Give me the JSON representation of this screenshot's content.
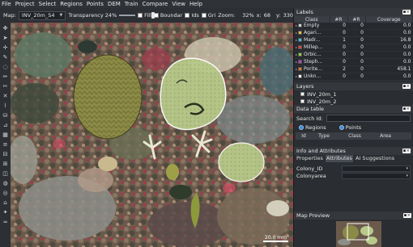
{
  "menu": [
    "File",
    "Project",
    "Select",
    "Regions",
    "Points",
    "DEM",
    "Train",
    "Compare",
    "View",
    "Help"
  ],
  "toolbar": {
    "map_label": "Map:",
    "map_value": "INV_20m_S4",
    "transparency_label": "Transparency 24%",
    "transparency": 0.24,
    "fill_label": "Fill",
    "boundaries_label": "Boundar",
    "ids_label": "Ids",
    "grid_label": "Gri",
    "zoom_label": "Zoom:",
    "zoom_value": "32%",
    "x_label": "x:",
    "x_value": "68",
    "y_label": "y:",
    "y_value": "330"
  },
  "map": {
    "scale_text": "20.0 mm"
  },
  "labels_panel": {
    "title": "Labels",
    "columns": [
      "Class",
      "#R",
      "#R",
      "Coverage"
    ],
    "rows": [
      {
        "name": "Empty",
        "color": "#cfcfcf",
        "r1": "0",
        "r2": "0",
        "coverage": "0.0"
      },
      {
        "name": "Agari...",
        "color": "#e8c23a",
        "r1": "0",
        "r2": "0",
        "coverage": "0.0"
      },
      {
        "name": "Madr...",
        "color": "#48c1dd",
        "r1": "1",
        "r2": "0",
        "coverage": "16.8"
      },
      {
        "name": "Millep...",
        "color": "#e2453a",
        "r1": "0",
        "r2": "0",
        "coverage": "0.0"
      },
      {
        "name": "Orbic...",
        "color": "#8ad33a",
        "r1": "0",
        "r2": "0",
        "coverage": "0.0"
      },
      {
        "name": "Steph...",
        "color": "#c23fd6",
        "r1": "0",
        "r2": "0",
        "coverage": "0.0"
      },
      {
        "name": "Porite...",
        "color": "#e07a1e",
        "r1": "2",
        "r2": "0",
        "coverage": "458.1"
      },
      {
        "name": "Unkn...",
        "color": "#ffffff",
        "r1": "0",
        "r2": "0",
        "coverage": "0.0"
      }
    ]
  },
  "layers_panel": {
    "title": "Layers",
    "items": [
      "INV_20m_1",
      "INV_20m_2"
    ]
  },
  "data_table": {
    "title": "Data table",
    "search_label": "Search Id:",
    "regions_label": "Regions",
    "points_label": "Points",
    "columns": [
      "Id",
      "Type",
      "Class",
      "Area"
    ]
  },
  "info_panel": {
    "title": "Info and Attributes",
    "tabs": [
      "Properties",
      "Attributes",
      "AI Suggestions"
    ],
    "fields": [
      "Colony_ID",
      "Colonyarea"
    ]
  },
  "map_preview": {
    "title": "Map Preview"
  },
  "colors": {
    "accent": "#3a8bd9",
    "panel": "#2a2d31"
  }
}
